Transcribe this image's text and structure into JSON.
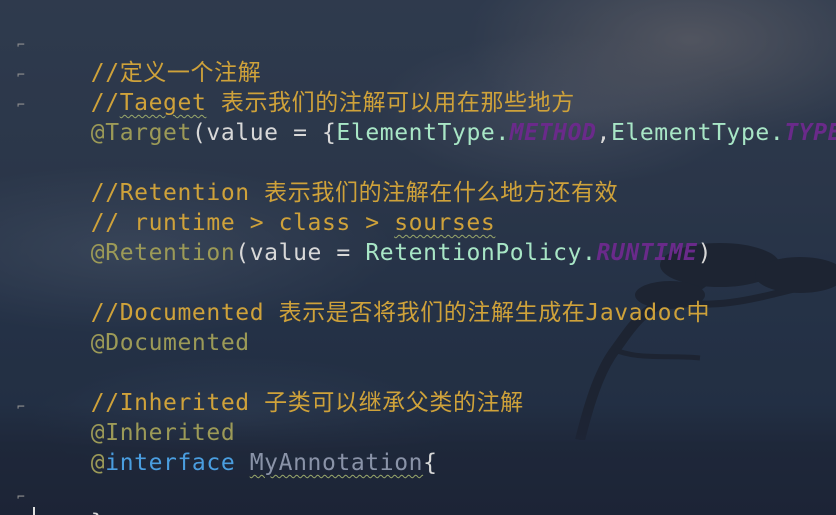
{
  "code": {
    "l1": "//定义一个注解",
    "l2_prefix": "//",
    "l2_word": "Taeget",
    "l2_rest": " 表示我们的注解可以用在那些地方",
    "l3_at": "@Target",
    "l3_open": "(value = {",
    "l3_cls1": "ElementType.",
    "l3_enum1": "METHOD",
    "l3_comma": ",",
    "l3_cls2": "ElementType.",
    "l3_enum2": "TYPE",
    "l3_close": "})",
    "l5": "//Retention 表示我们的注解在什么地方还有效",
    "l6_prefix": "// runtime > class > ",
    "l6_word": "sourses",
    "l7_at": "@Retention",
    "l7_open": "(value = ",
    "l7_cls": "RetentionPolicy.",
    "l7_enum": "RUNTIME",
    "l7_close": ")",
    "l9": "//Documented 表示是否将我们的注解生成在Javadoc中",
    "l10": "@Documented",
    "l12": "//Inherited 子类可以继承父类的注解",
    "l13": "@Inherited",
    "l14_at": "@",
    "l14_kw": "interface",
    "l14_sp": " ",
    "l14_name": "MyAnnotation",
    "l14_brace": "{",
    "l16": "}"
  },
  "colors": {
    "comment": "#cfa23a",
    "annotation": "#9c9a57",
    "class_ref": "#a8e6c6",
    "enum_const": "#6a2a8a",
    "keyword": "#4a9ee0"
  }
}
